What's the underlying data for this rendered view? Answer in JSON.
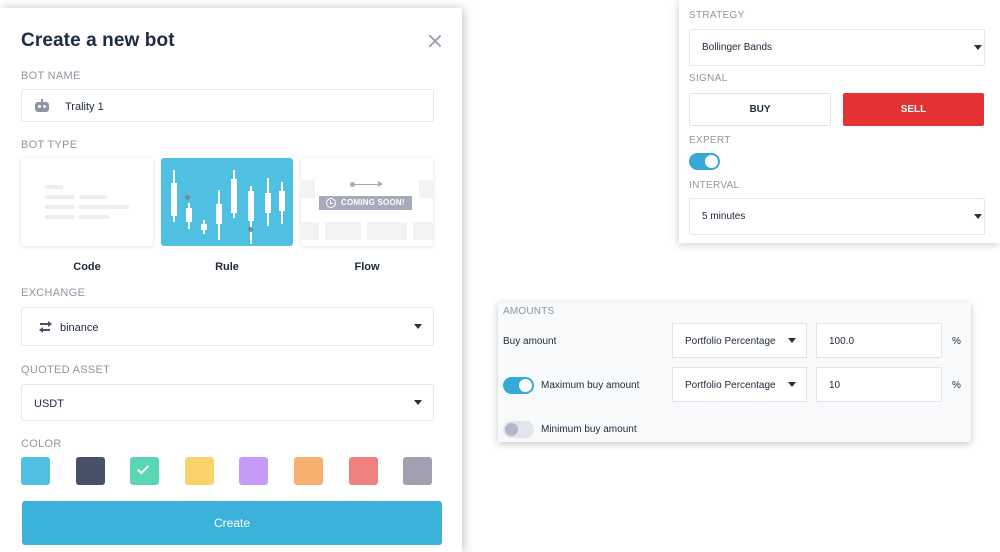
{
  "modal": {
    "title": "Create a new bot",
    "bot_name": {
      "label": "BOT NAME",
      "value": "Trality 1"
    },
    "bot_type": {
      "label": "BOT TYPE",
      "options": [
        {
          "label": "Code",
          "selected": false
        },
        {
          "label": "Rule",
          "selected": true
        },
        {
          "label": "Flow",
          "selected": false,
          "badge": "COMING SOON!"
        }
      ]
    },
    "exchange": {
      "label": "EXCHANGE",
      "value": "binance"
    },
    "quoted_asset": {
      "label": "QUOTED ASSET",
      "value": "USDT"
    },
    "color": {
      "label": "COLOR",
      "selected_index": 2,
      "swatches": [
        "#4fc0e1",
        "#465067",
        "#5bd6b4",
        "#f8d36a",
        "#c49bf7",
        "#f8b06f",
        "#f07f7f",
        "#a29fb2"
      ]
    },
    "create_label": "Create"
  },
  "strategy_panel": {
    "strategy": {
      "label": "STRATEGY",
      "value": "Bollinger Bands"
    },
    "signal": {
      "label": "SIGNAL",
      "buy_label": "BUY",
      "sell_label": "SELL",
      "selected": "SELL"
    },
    "expert": {
      "label": "EXPERT",
      "on": true
    },
    "interval": {
      "label": "INTERVAL",
      "value": "5 minutes"
    }
  },
  "amounts_panel": {
    "title": "AMOUNTS",
    "rows": [
      {
        "label": "Buy amount",
        "type": "Portfolio Percentage",
        "value": "100.0",
        "unit": "%"
      },
      {
        "label": "Maximum buy amount",
        "toggle": true,
        "type": "Portfolio Percentage",
        "value": "10",
        "unit": "%"
      },
      {
        "label": "Minimum buy amount",
        "toggle": false
      }
    ]
  },
  "colors": {
    "accent": "#3bb2da",
    "sell": "#e43232",
    "toggle_on": "#36a9d8"
  }
}
